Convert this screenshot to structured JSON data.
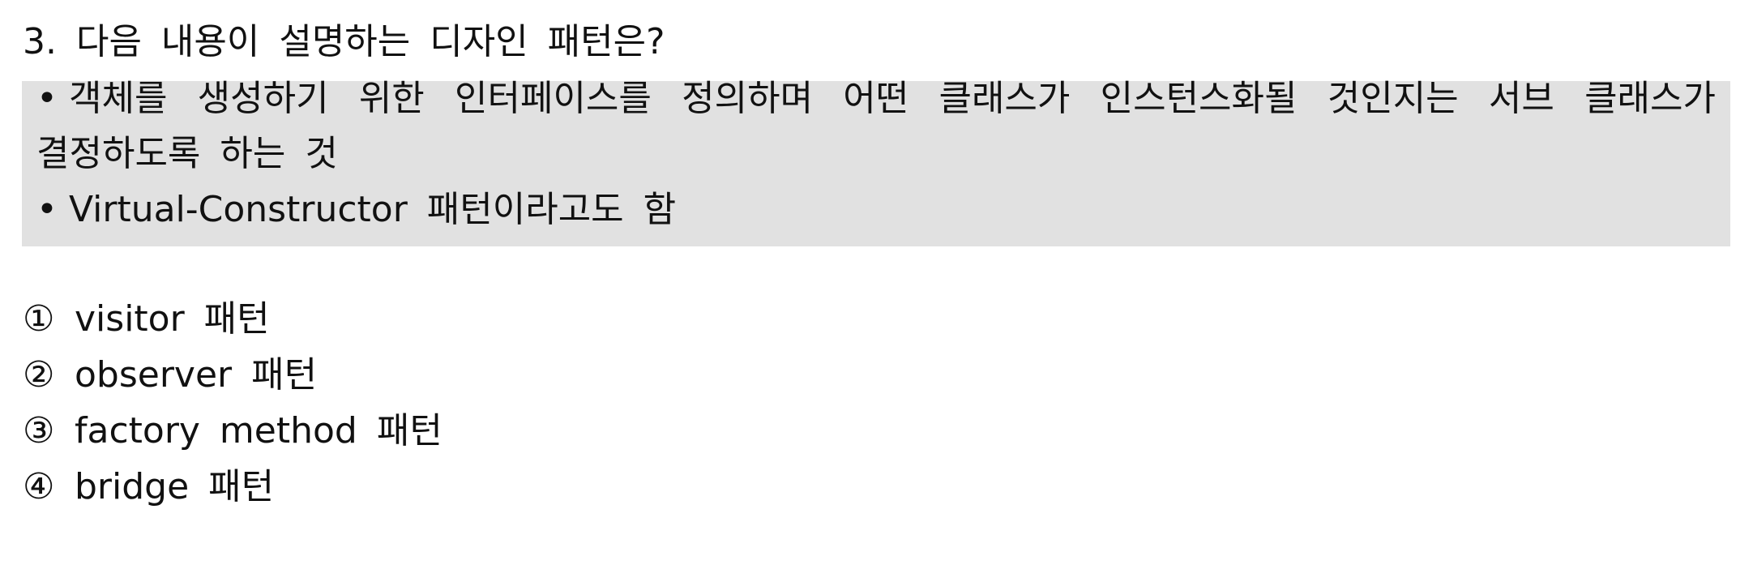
{
  "question": {
    "title": "3. 다음 내용이 설명하는 디자인 패턴은?"
  },
  "description_box": {
    "bullet_symbol": "•",
    "line1": "객체를 생성하기 위한 인터페이스를 정의하며 어떤 클래스가 인스턴스화될 것인지는 서브 클래스가",
    "line2": "결정하도록 하는 것",
    "line3": "Virtual-Constructor 패턴이라고도 함"
  },
  "choices": [
    {
      "number": "①",
      "text": "visitor 패턴"
    },
    {
      "number": "②",
      "text": "observer 패턴"
    },
    {
      "number": "③",
      "text": "factory method 패턴"
    },
    {
      "number": "④",
      "text": "bridge 패턴"
    }
  ],
  "colors": {
    "box_background": "#e1e1e1",
    "text": "#111111"
  }
}
